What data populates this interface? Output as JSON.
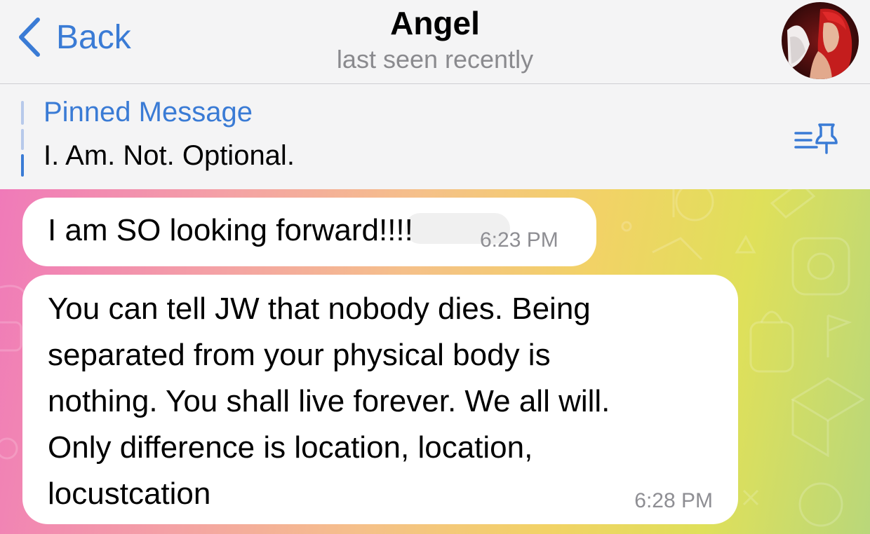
{
  "header": {
    "back_label": "Back",
    "title": "Angel",
    "subtitle": "last seen recently",
    "avatar_icon": "avatar-angel"
  },
  "pinned": {
    "title": "Pinned Message",
    "text": "I. Am. Not. Optional.",
    "icon": "pin-list-icon"
  },
  "colors": {
    "accent": "#3a7bd5",
    "time_gray": "#8e8e93"
  },
  "messages": [
    {
      "text": "I am SO looking forward!!!!",
      "time": "6:23 PM"
    },
    {
      "text": "You can tell JW that nobody dies.  Being\nseparated from your physical body is\nnothing.  You shall live forever.  We all will.\nOnly difference is location, location,\nlocustcation",
      "time": "6:28 PM"
    }
  ]
}
